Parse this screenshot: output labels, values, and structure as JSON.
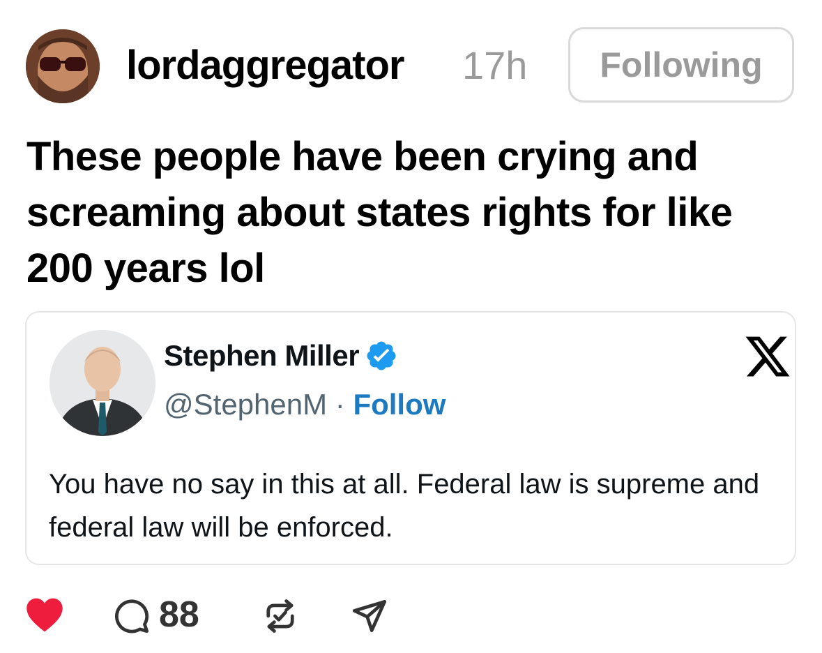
{
  "post": {
    "username": "lordaggregator",
    "timestamp": "17h",
    "follow_button_label": "Following",
    "text": "These people have been crying and screaming about states rights for like 200 years lol"
  },
  "embed": {
    "display_name": "Stephen Miller",
    "handle": "@StephenM",
    "separator": "·",
    "follow_label": "Follow",
    "body": "You have no say in this at all. Federal law is supreme and federal law will be enforced.",
    "platform_icon": "x-logo-icon",
    "verified": true
  },
  "actions": {
    "like_icon": "heart-icon",
    "like_color": "#ee1c3d",
    "comment_icon": "comment-icon",
    "comment_count": "88",
    "repost_icon": "repost-icon",
    "share_icon": "send-icon"
  },
  "colors": {
    "muted_text": "#9a9a9a",
    "verified_blue": "#1d9bf0",
    "follow_link": "#1d7ac0"
  }
}
